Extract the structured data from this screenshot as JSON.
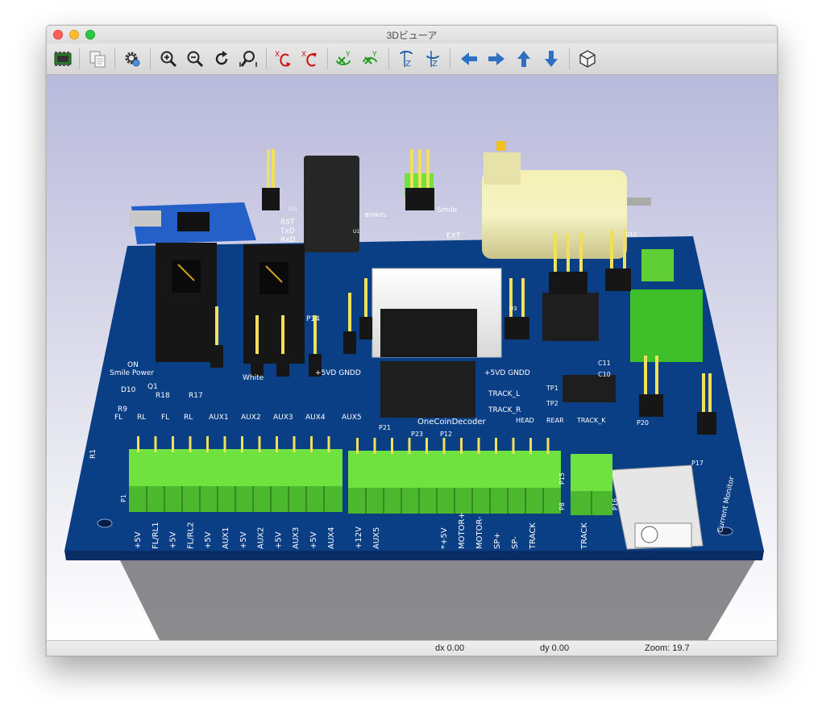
{
  "window": {
    "title": "3Dビューア"
  },
  "toolbar": {
    "buttons": [
      {
        "name": "reload-board-button",
        "icon": "pcb-reload-icon"
      },
      {
        "name": "copy-image-button",
        "icon": "copy-icon"
      },
      {
        "name": "settings-button",
        "icon": "settings-gear-icon"
      },
      {
        "name": "zoom-in-button",
        "icon": "zoom-in-icon"
      },
      {
        "name": "zoom-out-button",
        "icon": "zoom-out-icon"
      },
      {
        "name": "refresh-button",
        "icon": "redraw-icon"
      },
      {
        "name": "zoom-fit-button",
        "icon": "zoom-fit-icon"
      },
      {
        "name": "rotate-x-cw-button",
        "icon": "rotate-x-cw-icon"
      },
      {
        "name": "rotate-x-ccw-button",
        "icon": "rotate-x-ccw-icon"
      },
      {
        "name": "rotate-y-cw-button",
        "icon": "rotate-y-cw-icon"
      },
      {
        "name": "rotate-y-ccw-button",
        "icon": "rotate-y-ccw-icon"
      },
      {
        "name": "rotate-z-cw-button",
        "icon": "rotate-z-cw-icon"
      },
      {
        "name": "rotate-z-ccw-button",
        "icon": "rotate-z-ccw-icon"
      },
      {
        "name": "pan-left-button",
        "icon": "arrow-left-icon"
      },
      {
        "name": "pan-right-button",
        "icon": "arrow-right-icon"
      },
      {
        "name": "pan-up-button",
        "icon": "arrow-up-icon"
      },
      {
        "name": "pan-down-button",
        "icon": "arrow-down-icon"
      },
      {
        "name": "projection-toggle-button",
        "icon": "ortho-cube-icon"
      }
    ]
  },
  "status": {
    "dx": "dx 0.00",
    "dy": "dy 0.00",
    "zoom": "Zoom: 19.7"
  },
  "colors": {
    "pcb": "#0a3f86",
    "pcb_edge": "#0a2d66",
    "terminal_green": "#6fe23f",
    "header_black": "#161616",
    "bg_top": "#b9b9dc",
    "bg_bottom": "#ffffff"
  },
  "board": {
    "title": "OneCoinDecoder",
    "labels": {
      "smile_power": "Smile Power",
      "on": "ON",
      "current_monitor": "Current Monitor",
      "ext": "EXT",
      "smile_top": "Smile",
      "bypass": "BYPASS",
      "rst": "RST",
      "txd": "TxD",
      "rxd": "RxD",
      "white": "White",
      "p14": "P14",
      "p21": "P21",
      "p23": "P23",
      "p12": "P12",
      "p17": "P17",
      "p20": "P20",
      "p1": "P1",
      "p8": "P8",
      "p15": "P15",
      "p16": "P16",
      "tp1": "TP1",
      "tp2": "TP2",
      "track_l": "TRACK_L",
      "track_r": "TRACK_R",
      "head": "HEAD",
      "rear": "REAR",
      "track_k": "TRACK_K",
      "vdd_gnd_left": "+5VD GNDD",
      "vdd_gnd_right": "+5VD GNDD",
      "d10": "D10",
      "q1": "Q1",
      "r18": "R18",
      "r17": "R17",
      "r9": "R9",
      "r1": "R1",
      "c11": "C11",
      "c10": "C10",
      "d12": "D12",
      "ls1": "LS1",
      "u1": "U1",
      "u3": "U3"
    },
    "top_led_labels": [
      "FL",
      "RL",
      "FL",
      "RL",
      "AUX1",
      "AUX2",
      "AUX3",
      "AUX4",
      "AUX5"
    ],
    "terminal_left_labels": [
      "+5V",
      "FL/RL1",
      "+5V",
      "FL/RL2",
      "+5V",
      "AUX1",
      "+5V",
      "AUX2",
      "+5V",
      "AUX3",
      "+5V",
      "AUX4"
    ],
    "terminal_mid_labels": [
      "+12V",
      "AUX5",
      "*+5V",
      "MOTOR+",
      "MOTOR-",
      "SP+",
      "SP-",
      "TRACK"
    ],
    "terminal_right_labels": [
      "TRACK"
    ]
  }
}
